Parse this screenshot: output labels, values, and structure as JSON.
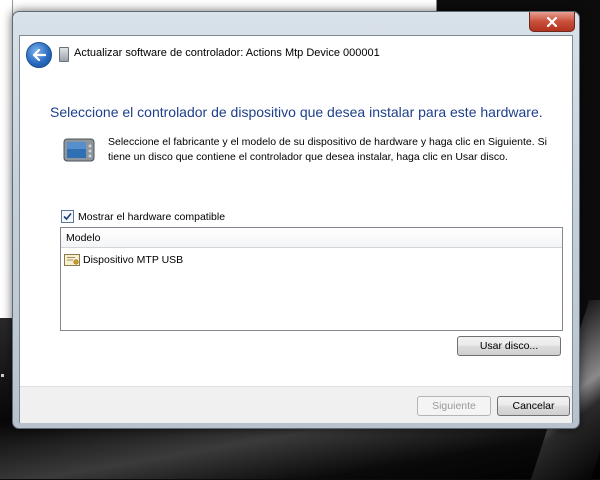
{
  "window": {
    "title": "Actualizar software de controlador: Actions Mtp Device 000001"
  },
  "main": {
    "heading": "Seleccione el controlador de dispositivo que desea instalar para este hardware.",
    "instructions": "Seleccione el fabricante y el modelo de su dispositivo de hardware y haga clic en Siguiente. Si tiene un disco que contiene el controlador que desea instalar, haga clic en  Usar disco.",
    "compatible_checkbox": {
      "label": "Mostrar el hardware compatible",
      "checked": true
    },
    "model_list": {
      "header": "Modelo",
      "items": [
        {
          "label": "Dispositivo MTP USB",
          "icon": "certificate-driver-icon"
        }
      ]
    },
    "use_disk_button": "Usar disco..."
  },
  "footer": {
    "next_button": "Siguiente",
    "cancel_button": "Cancelar"
  },
  "icons": {
    "close": "close-icon",
    "back": "back-arrow-icon",
    "device": "portable-device-icon"
  },
  "colors": {
    "heading": "#1e3f8c",
    "close_button": "#c9503b",
    "back_button": "#2b6cc2"
  }
}
